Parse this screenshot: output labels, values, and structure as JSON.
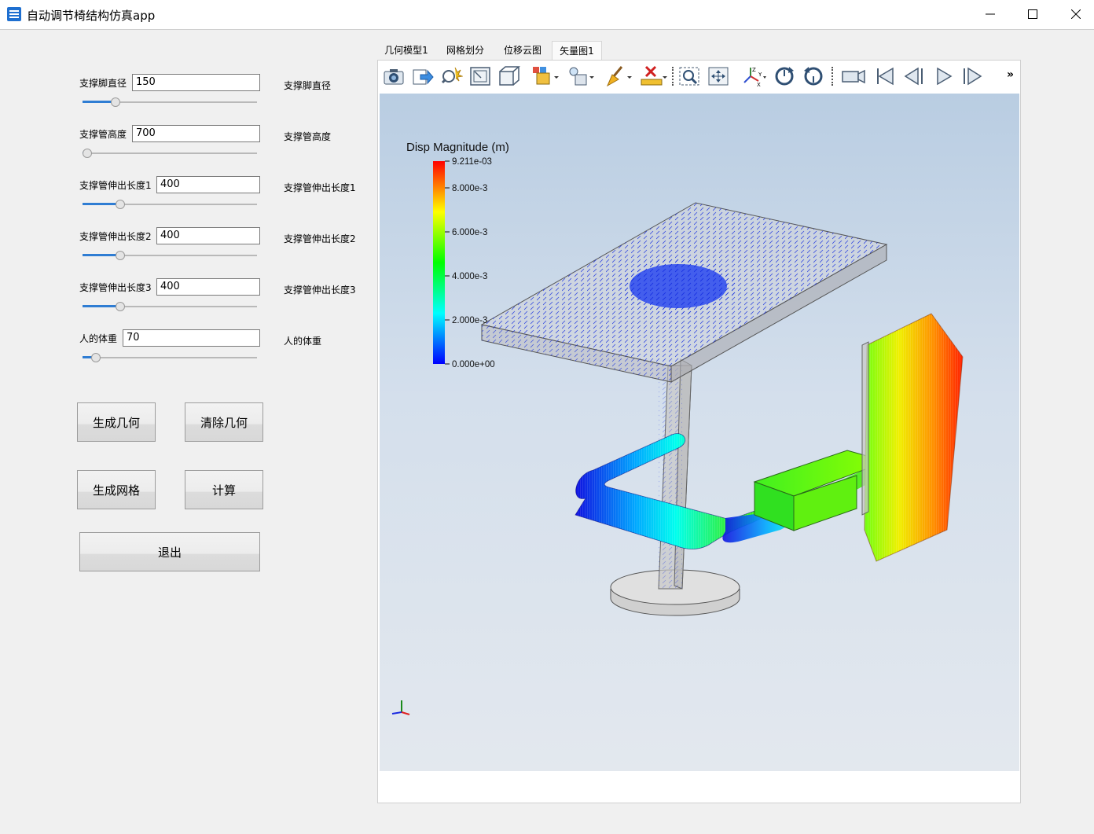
{
  "window": {
    "title": "自动调节椅结构仿真app"
  },
  "params": [
    {
      "label": "支撑脚直径",
      "value": "150",
      "side_label": "支撑脚直径",
      "slider_fraction": 0.17
    },
    {
      "label": "支撑管高度",
      "value": "700",
      "side_label": "支撑管高度",
      "slider_fraction": 0.0
    },
    {
      "label": "支撑管伸出长度1",
      "value": "400",
      "side_label": "支撑管伸出长度1",
      "slider_fraction": 0.2
    },
    {
      "label": "支撑管伸出长度2",
      "value": "400",
      "side_label": "支撑管伸出长度2",
      "slider_fraction": 0.2
    },
    {
      "label": "支撑管伸出长度3",
      "value": "400",
      "side_label": "支撑管伸出长度3",
      "slider_fraction": 0.2
    },
    {
      "label": "人的体重",
      "value": "70",
      "side_label": "人的体重",
      "slider_fraction": 0.05
    }
  ],
  "buttons": {
    "generate_geometry": "生成几何",
    "clear_geometry": "清除几何",
    "generate_mesh": "生成网格",
    "compute": "计算",
    "exit": "退出"
  },
  "tabs": [
    {
      "label": "几何模型1",
      "active": false
    },
    {
      "label": "网格划分",
      "active": false
    },
    {
      "label": "位移云图",
      "active": false
    },
    {
      "label": "矢量图1",
      "active": true
    }
  ],
  "toolbar": {
    "items": [
      "camera-icon",
      "export-icon",
      "magic-zoom-icon",
      "zoom-fit-icon",
      "box-view-icon",
      "display-mode-icon",
      "light-icon",
      "paint-icon",
      "delete-ruler-icon",
      "zoom-box-icon",
      "pan-icon",
      "axes-icon",
      "rotate-cw-icon",
      "rotate-ccw-icon",
      "video-icon",
      "first-frame-icon",
      "prev-frame-icon",
      "play-icon",
      "next-frame-icon"
    ],
    "more": "»"
  },
  "colorbar": {
    "title": "Disp Magnitude (m)",
    "ticks": [
      "9.211e-03",
      "8.000e-3",
      "6.000e-3",
      "4.000e-3",
      "2.000e-3",
      "0.000e+00"
    ],
    "min": 0.0,
    "max": 0.009211,
    "colormap": [
      "#0000ff",
      "#00ffff",
      "#00ff00",
      "#ffff00",
      "#ff0000"
    ]
  },
  "colors": {
    "accent": "#2f7dd3",
    "scene_top": "#b9cde2",
    "scene_bottom": "#e3e8ee"
  }
}
